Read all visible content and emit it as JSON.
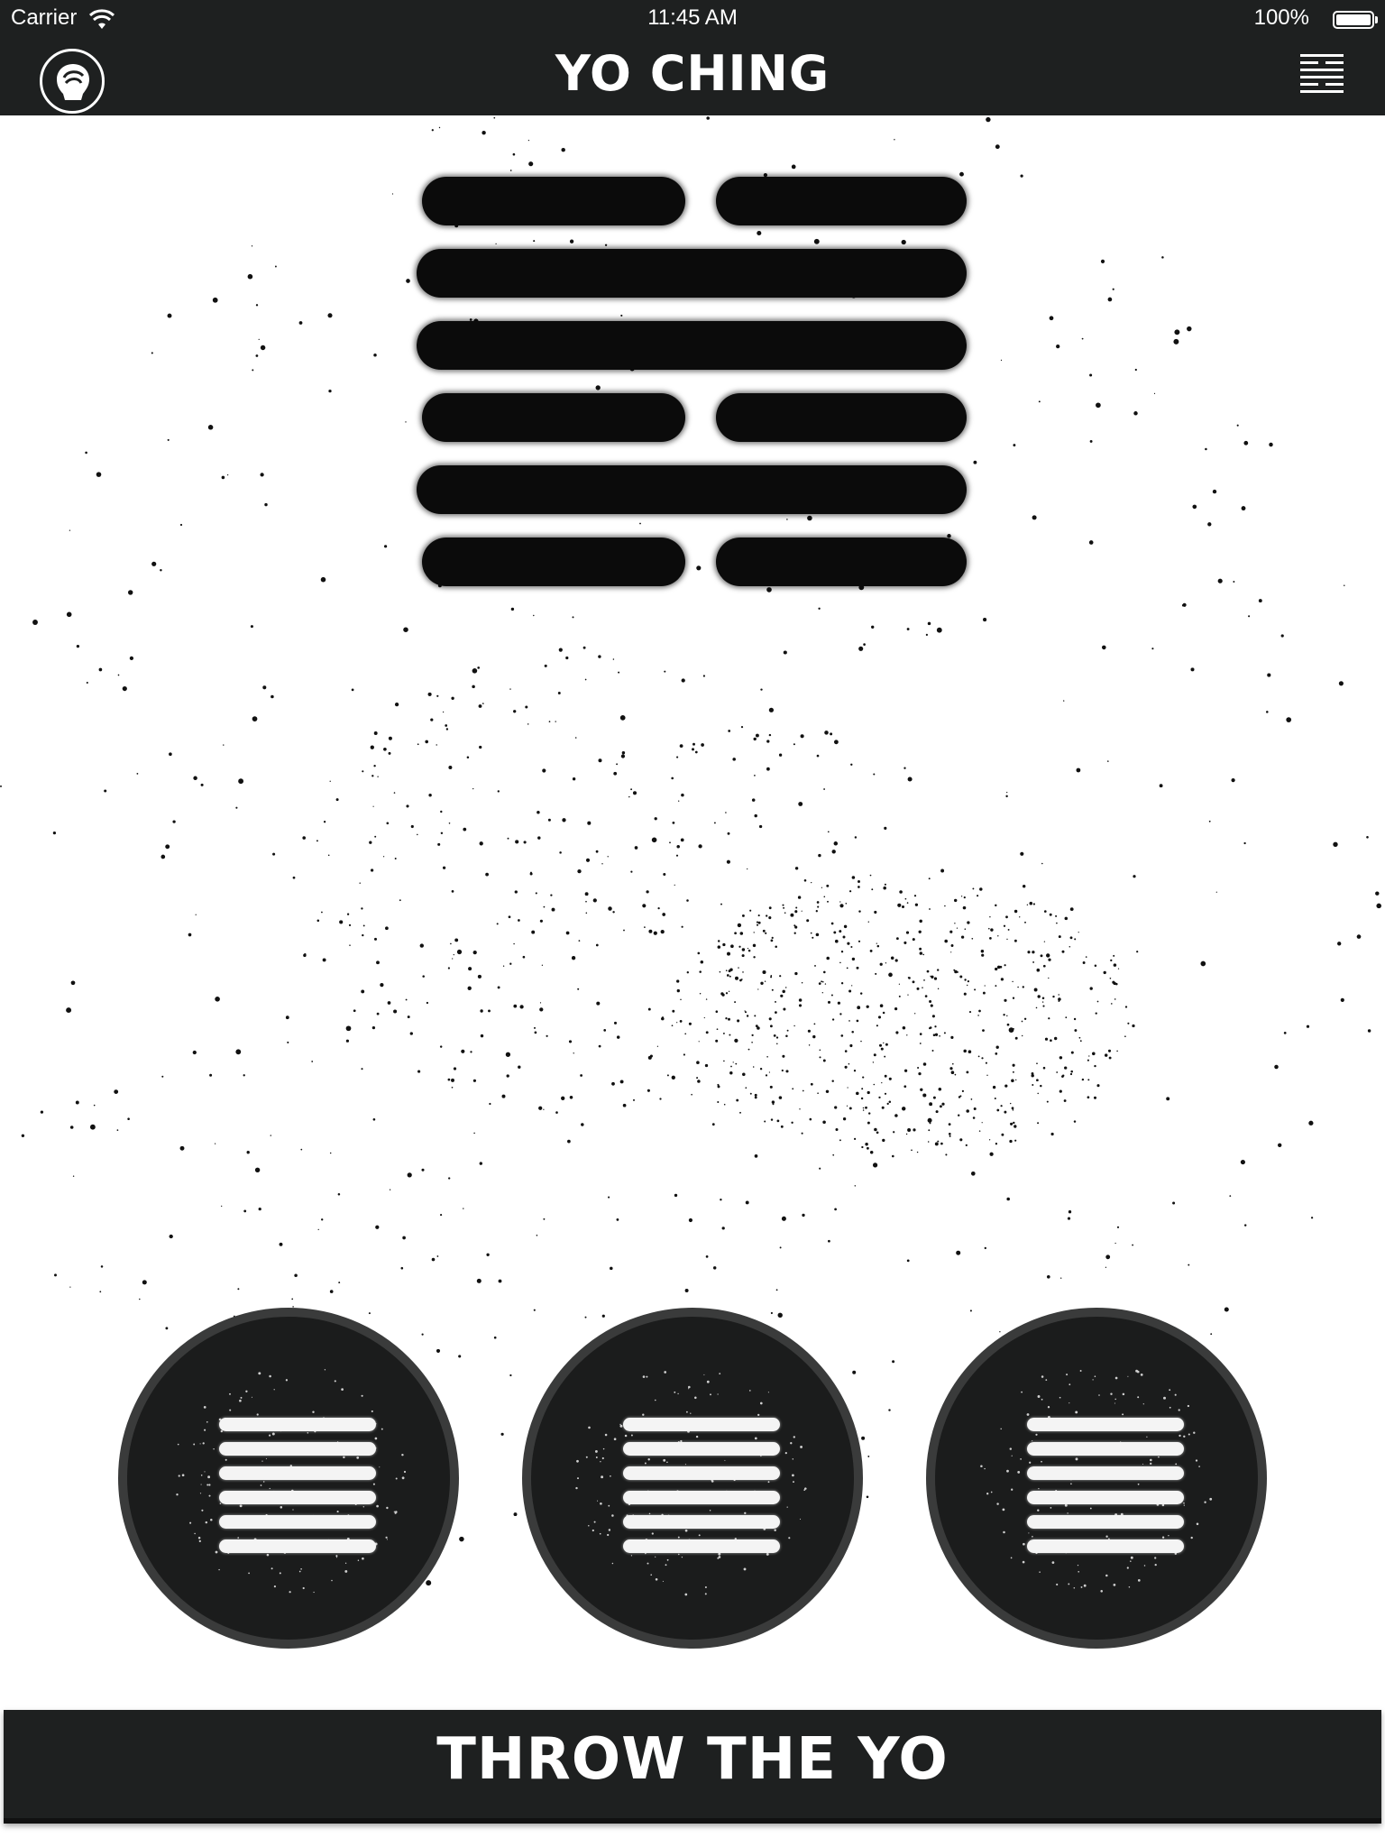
{
  "status_bar": {
    "carrier": "Carrier",
    "time": "11:45 AM",
    "battery_percent": "100%"
  },
  "nav": {
    "title": "YO CHING",
    "left_icon": "yo-logo-icon",
    "right_icon": "hexagram-menu-icon"
  },
  "hexagram": {
    "lines_top_to_bottom": [
      "broken",
      "solid",
      "solid",
      "broken",
      "solid",
      "broken"
    ]
  },
  "coins": [
    {
      "icon": "hexagram-coin-icon"
    },
    {
      "icon": "hexagram-coin-icon"
    },
    {
      "icon": "hexagram-coin-icon"
    }
  ],
  "action": {
    "throw_label": "THROW THE YO"
  },
  "colors": {
    "bar": "#1e2020",
    "ink": "#0b0b0b",
    "coin_fill": "#1b1c1c",
    "coin_ring": "#3a3b3b"
  }
}
